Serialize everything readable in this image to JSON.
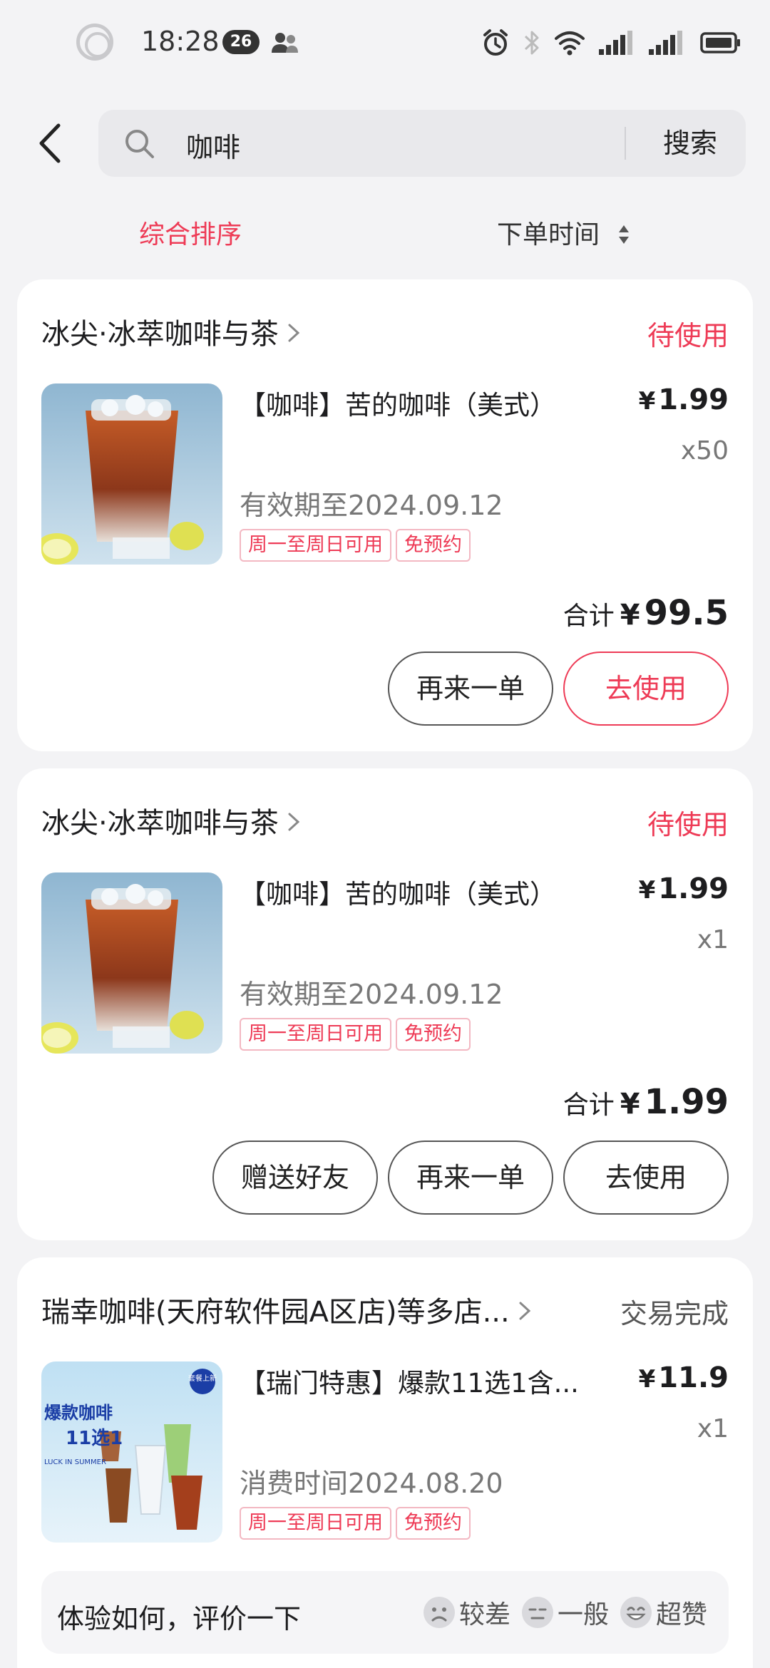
{
  "status_bar": {
    "time": "18:28",
    "badge": "26"
  },
  "header": {
    "search_value": "咖啡",
    "search_button": "搜索"
  },
  "sort": {
    "active": "综合排序",
    "order_time": "下单时间"
  },
  "orders": [
    {
      "shop": "冰尖·冰萃咖啡与茶",
      "status": "待使用",
      "product": "【咖啡】苦的咖啡（美式）",
      "currency": "¥",
      "price": "1.99",
      "qty": "x50",
      "validity": "有效期至2024.09.12",
      "tags": [
        "周一至周日可用",
        "免预约"
      ],
      "total_label": "合计",
      "total": "99.5",
      "buttons": [
        "再来一单",
        "去使用"
      ]
    },
    {
      "shop": "冰尖·冰萃咖啡与茶",
      "status": "待使用",
      "product": "【咖啡】苦的咖啡（美式）",
      "currency": "¥",
      "price": "1.99",
      "qty": "x1",
      "validity": "有效期至2024.09.12",
      "tags": [
        "周一至周日可用",
        "免预约"
      ],
      "total_label": "合计",
      "total": "1.99",
      "buttons": [
        "赠送好友",
        "再来一单",
        "去使用"
      ]
    },
    {
      "shop": "瑞幸咖啡(天府软件园A区店)等多店...",
      "status": "交易完成",
      "product": "【瑞门特惠】爆款11选1含...",
      "currency": "¥",
      "price": "11.9",
      "qty": "x1",
      "validity": "消费时间2024.08.20",
      "tags": [
        "周一至周日可用",
        "免预约"
      ],
      "thumb_text": {
        "line1": "爆款咖啡",
        "line2": "11选1",
        "side": "LUCK IN SUMMER",
        "badge": "套餐上新"
      },
      "rating": {
        "question": "体验如何，评价一下",
        "options": [
          "较差",
          "一般",
          "超赞"
        ]
      }
    }
  ],
  "colors": {
    "accent": "#ee3b56",
    "background": "#f3f3f5",
    "card": "#ffffff"
  }
}
